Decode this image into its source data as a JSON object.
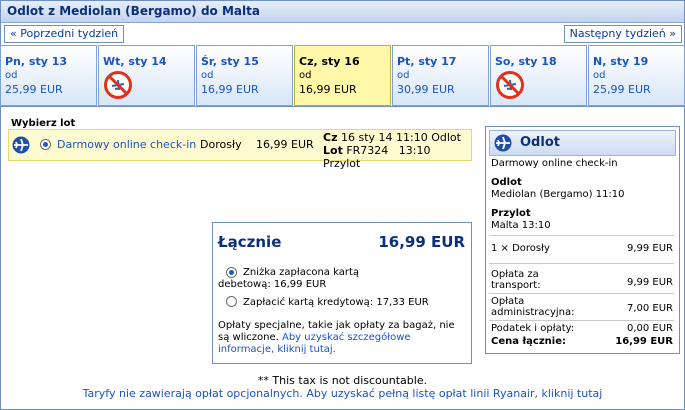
{
  "header": {
    "title": "Odlot  z Mediolan (Bergamo) do Malta"
  },
  "nav": {
    "prev_label": "« Poprzedni tydzień",
    "next_label": "Następny tydzień »"
  },
  "days": [
    {
      "label": "Pn, sty 13",
      "from": "od",
      "price": "25,99 EUR",
      "available": true,
      "selected": false
    },
    {
      "label": "Wt, sty 14",
      "from": "",
      "price": "",
      "available": false,
      "selected": false
    },
    {
      "label": "Śr, sty 15",
      "from": "od",
      "price": "16,99 EUR",
      "available": true,
      "selected": false
    },
    {
      "label": "Cz, sty 16",
      "from": "od",
      "price": "16,99 EUR",
      "available": true,
      "selected": true
    },
    {
      "label": "Pt, sty 17",
      "from": "od",
      "price": "30,99 EUR",
      "available": true,
      "selected": false
    },
    {
      "label": "So, sty 18",
      "from": "",
      "price": "",
      "available": false,
      "selected": false
    },
    {
      "label": "N, sty 19",
      "from": "od",
      "price": "25,99 EUR",
      "available": true,
      "selected": false
    }
  ],
  "flight_select": {
    "heading": "Wybierz lot",
    "checkin": "Darmowy online check-in",
    "passenger": "Dorosły",
    "price": "16,99 EUR",
    "day_abbr": "Cz",
    "date_time": "16 sty 14 11:10",
    "depart_word": "Odlot",
    "flight_word": "Lot",
    "flight_number": "FR7324",
    "arrive_time": "13:10",
    "arrive_word": "Przylot"
  },
  "summary": {
    "title": "Odlot",
    "checkin": "Darmowy online check-in",
    "depart_label": "Odlot",
    "depart_value": "Mediolan (Bergamo) 11:10",
    "arrive_label": "Przylot",
    "arrive_value": "Malta 13:10",
    "passenger_line": "1 × Dorosły",
    "passenger_value": "9,99 EUR",
    "transport_label": "Opłata za transport:",
    "transport_value": "9,99 EUR",
    "admin_label": "Opłata administracyjna:",
    "admin_value": "7,00 EUR",
    "tax_label": "Podatek i opłaty:",
    "tax_value": "0,00 EUR",
    "total_label": "Cena łącznie:",
    "total_value": "16,99 EUR"
  },
  "total": {
    "label": "Łącznie",
    "value": "16,99 EUR",
    "option1_line1": "Zniżka zapłacona kartą",
    "option1_line2": "debetową: 16,99 EUR",
    "option2": "Zapłacić kartą kredytową: 17,33 EUR",
    "fees_text": "Opłaty specjalne, takie jak opłaty za bagaż, nie są wliczone.",
    "fees_link": "Aby uzyskać szczegółowe informacje, kliknij tutaj."
  },
  "notes": {
    "tax": "** This tax is not discountable.",
    "fares": "Taryfy nie zawierają opłat opcjonalnych. Aby uzyskać pełną listę opłat linii Ryanair, kliknij tutaj"
  }
}
